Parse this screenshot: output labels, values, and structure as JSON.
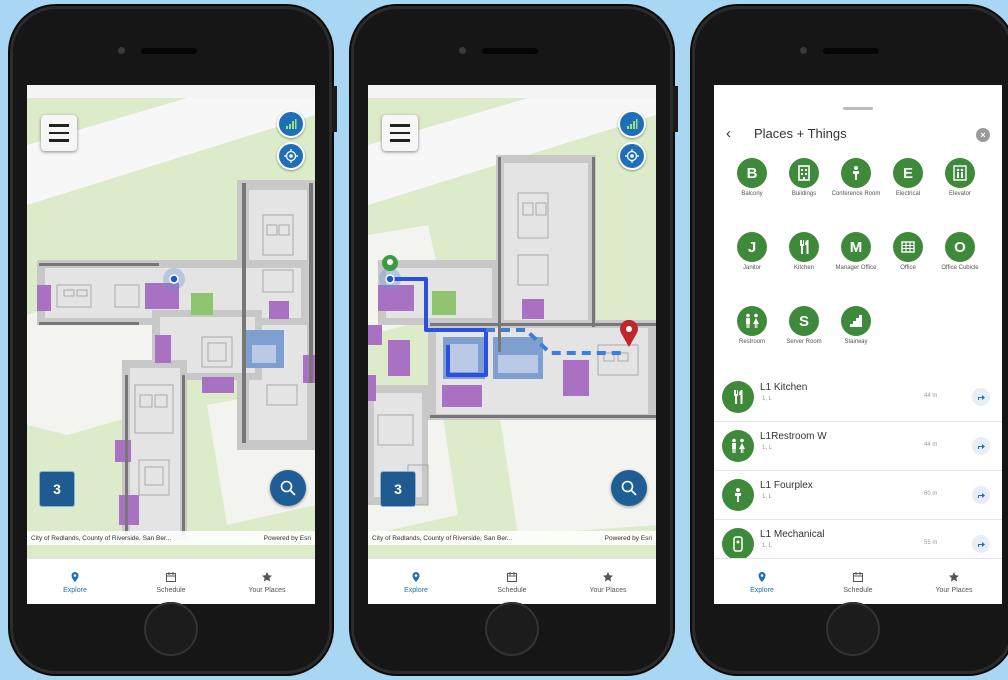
{
  "phones": [
    {
      "map": {
        "floor_label": "3",
        "attribution_left": "City of Redlands, County of Riverside, San Ber...",
        "attribution_right": "Powered by Esri"
      },
      "tabs": [
        {
          "label": "Explore",
          "icon": "location-pin-icon",
          "active": true
        },
        {
          "label": "Schedule",
          "icon": "calendar-icon",
          "active": false
        },
        {
          "label": "Your Places",
          "icon": "star-icon",
          "active": false
        }
      ]
    },
    {
      "map": {
        "floor_label": "3",
        "attribution_left": "City of Redlands, County of Riverside, San Ber...",
        "attribution_right": "Powered by Esri",
        "route_color": "#2b4fe3",
        "start_pin_color": "#3d9a44",
        "end_pin_color": "#c0272d"
      },
      "tabs": [
        {
          "label": "Explore",
          "icon": "location-pin-icon",
          "active": true
        },
        {
          "label": "Schedule",
          "icon": "calendar-icon",
          "active": false
        },
        {
          "label": "Your Places",
          "icon": "star-icon",
          "active": false
        }
      ]
    },
    {
      "places": {
        "title": "Places + Things",
        "categories": [
          {
            "glyph": "B",
            "label": "Balcony",
            "icon": "letter-b-icon"
          },
          {
            "glyph": "",
            "label": "Buildings",
            "icon": "building-icon"
          },
          {
            "glyph": "",
            "label": "Conference Room",
            "icon": "person-podium-icon"
          },
          {
            "glyph": "E",
            "label": "Electrical",
            "icon": "letter-e-icon"
          },
          {
            "glyph": "",
            "label": "Elevator",
            "icon": "elevator-icon"
          },
          {
            "glyph": "J",
            "label": "Janitor",
            "icon": "letter-j-icon"
          },
          {
            "glyph": "",
            "label": "Kitchen",
            "icon": "fork-knife-icon"
          },
          {
            "glyph": "M",
            "label": "Manager Office",
            "icon": "letter-m-icon"
          },
          {
            "glyph": "",
            "label": "Office",
            "icon": "grid-icon"
          },
          {
            "glyph": "O",
            "label": "Office Cubicle",
            "icon": "letter-o-icon"
          },
          {
            "glyph": "",
            "label": "Restroom",
            "icon": "restroom-icon"
          },
          {
            "glyph": "S",
            "label": "Server Room",
            "icon": "letter-s-icon"
          },
          {
            "glyph": "",
            "label": "Stairway",
            "icon": "stairs-icon"
          }
        ],
        "items": [
          {
            "title": "L1 Kitchen",
            "sub": "1, L",
            "distance": "44 m",
            "icon": "fork-knife-icon"
          },
          {
            "title": "L1Restroom W",
            "sub": "1, L",
            "distance": "44 m",
            "icon": "restroom-icon"
          },
          {
            "title": "L1 Fourplex",
            "sub": "1, L",
            "distance": "60 m",
            "icon": "person-podium-icon"
          },
          {
            "title": "L1 Mechanical",
            "sub": "1, L",
            "distance": "55 m",
            "icon": "mechanical-icon"
          }
        ]
      },
      "tabs": [
        {
          "label": "Explore",
          "icon": "location-pin-icon",
          "active": true
        },
        {
          "label": "Schedule",
          "icon": "calendar-icon",
          "active": false
        },
        {
          "label": "Your Places",
          "icon": "star-icon",
          "active": false
        }
      ]
    }
  ],
  "colors": {
    "accent": "#1f6fb8",
    "category_green": "#3e8a3a",
    "room_purple": "#a871c2",
    "room_blue": "#7f9fd0",
    "room_green": "#8ec46e",
    "background": "#a9d7f3"
  }
}
